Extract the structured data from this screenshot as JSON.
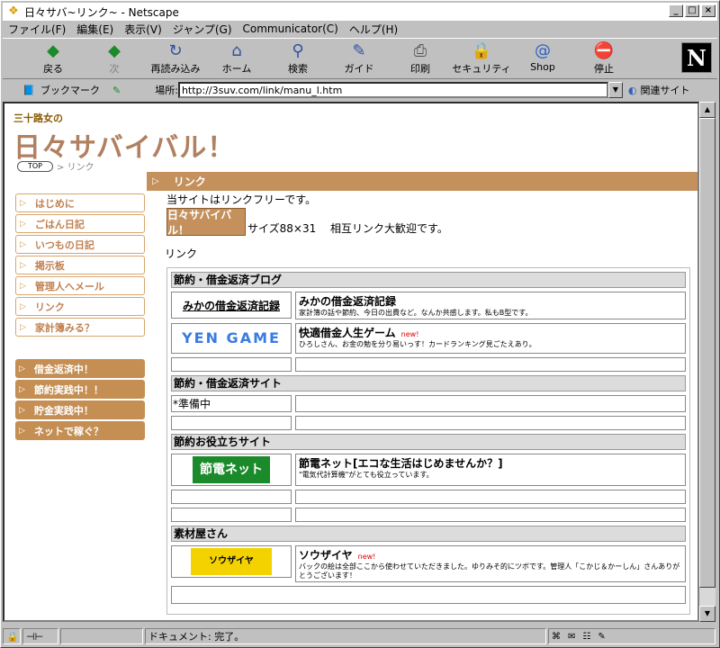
{
  "window": {
    "title": "日々サバ~リンク~ - Netscape"
  },
  "menu": [
    "ファイル(F)",
    "編集(E)",
    "表示(V)",
    "ジャンプ(G)",
    "Communicator(C)",
    "ヘルプ(H)"
  ],
  "toolbar": [
    {
      "label": "戻る",
      "icon": "back-arrow-icon",
      "glyph": "◆",
      "enabled": true
    },
    {
      "label": "次",
      "icon": "forward-arrow-icon",
      "glyph": "◆",
      "enabled": false
    },
    {
      "label": "再読み込み",
      "icon": "reload-icon",
      "glyph": "↻",
      "enabled": true
    },
    {
      "label": "ホーム",
      "icon": "home-icon",
      "glyph": "⌂",
      "enabled": true
    },
    {
      "label": "検索",
      "icon": "search-icon",
      "glyph": "⚲",
      "enabled": true
    },
    {
      "label": "ガイド",
      "icon": "guide-icon",
      "glyph": "✎",
      "enabled": true
    },
    {
      "label": "印刷",
      "icon": "print-icon",
      "glyph": "⎙",
      "enabled": true
    },
    {
      "label": "セキュリティ",
      "icon": "security-lock-icon",
      "glyph": "🔒",
      "enabled": true
    },
    {
      "label": "Shop",
      "icon": "shop-icon",
      "glyph": "@",
      "enabled": true
    },
    {
      "label": "停止",
      "icon": "stop-icon",
      "glyph": "⛔",
      "enabled": true
    }
  ],
  "brand": {
    "logo": "N"
  },
  "location": {
    "bookmarks": "ブックマーク",
    "label": "場所:",
    "url": "http://3suv.com/link/manu_l.htm",
    "related": "関連サイト"
  },
  "page": {
    "logo_line1": "三十路女の",
    "logo_line2": "日々サバイバル！",
    "crumb_top": "TOP",
    "crumb_current": "> リンク",
    "nav": [
      "はじめに",
      "ごはん日記",
      "いつもの日記",
      "掲示板",
      "管理人へメール",
      "リンク",
      "家計簿みる？"
    ],
    "nav2": [
      "借金返済中！",
      "節約実践中！！",
      "貯金実践中！",
      "ネットで稼ぐ？"
    ],
    "heading": "リンク",
    "intro": "当サイトはリンクフリーです。",
    "banner_label": "日々サバイバル！",
    "banner_text": "サイズ88×31　 相互リンク大歓迎です。",
    "link_label": "リンク",
    "sections": [
      {
        "title": "節約・借金返済ブログ",
        "rows": [
          {
            "banner": "みかの借金返済記録",
            "type": "text",
            "title": "みかの借金返済記録",
            "desc": "家計簿の話や節約、今日の出費など。なんか共感します。私もB型です。",
            "new": false
          },
          {
            "banner": "YEN GAME",
            "type": "yen",
            "title": "快適借金人生ゲーム",
            "desc": "ひろしさん、お金の勉を分り易いっす！カードランキング見ごたえあり。",
            "new": true
          },
          {
            "banner": "",
            "type": "empty",
            "title": "",
            "desc": "",
            "new": false
          }
        ]
      },
      {
        "title": "節約・借金返済サイト",
        "rows": [
          {
            "banner": "*準備中",
            "type": "left",
            "title": "",
            "desc": "",
            "new": false
          },
          {
            "banner": "",
            "type": "empty",
            "title": "",
            "desc": "",
            "new": false
          }
        ]
      },
      {
        "title": "節約お役立ちサイト",
        "rows": [
          {
            "banner": "節電ネット",
            "type": "setsu",
            "title": "節電ネット[エコな生活はじめませんか？]",
            "desc": "\"電気代計算機\"がとても役立っています。",
            "new": false
          },
          {
            "banner": "",
            "type": "empty",
            "title": "",
            "desc": "",
            "new": false
          },
          {
            "banner": "",
            "type": "empty",
            "title": "",
            "desc": "",
            "new": false
          }
        ]
      },
      {
        "title": "素材屋さん",
        "rows": [
          {
            "banner": "ソウザイヤ",
            "type": "souz",
            "title": "ソウザイヤ",
            "desc": "バックの絵は全部ここから使わせていただきました。ゆりみそ的にツボです。管理人「こかじ＆かーしん」さんありがとうございます！",
            "new": true
          },
          {
            "banner": "",
            "type": "wide",
            "title": "",
            "desc": "",
            "new": false
          }
        ]
      }
    ],
    "new_label": "new!"
  },
  "status": {
    "text": "ドキュメント: 完了。"
  }
}
